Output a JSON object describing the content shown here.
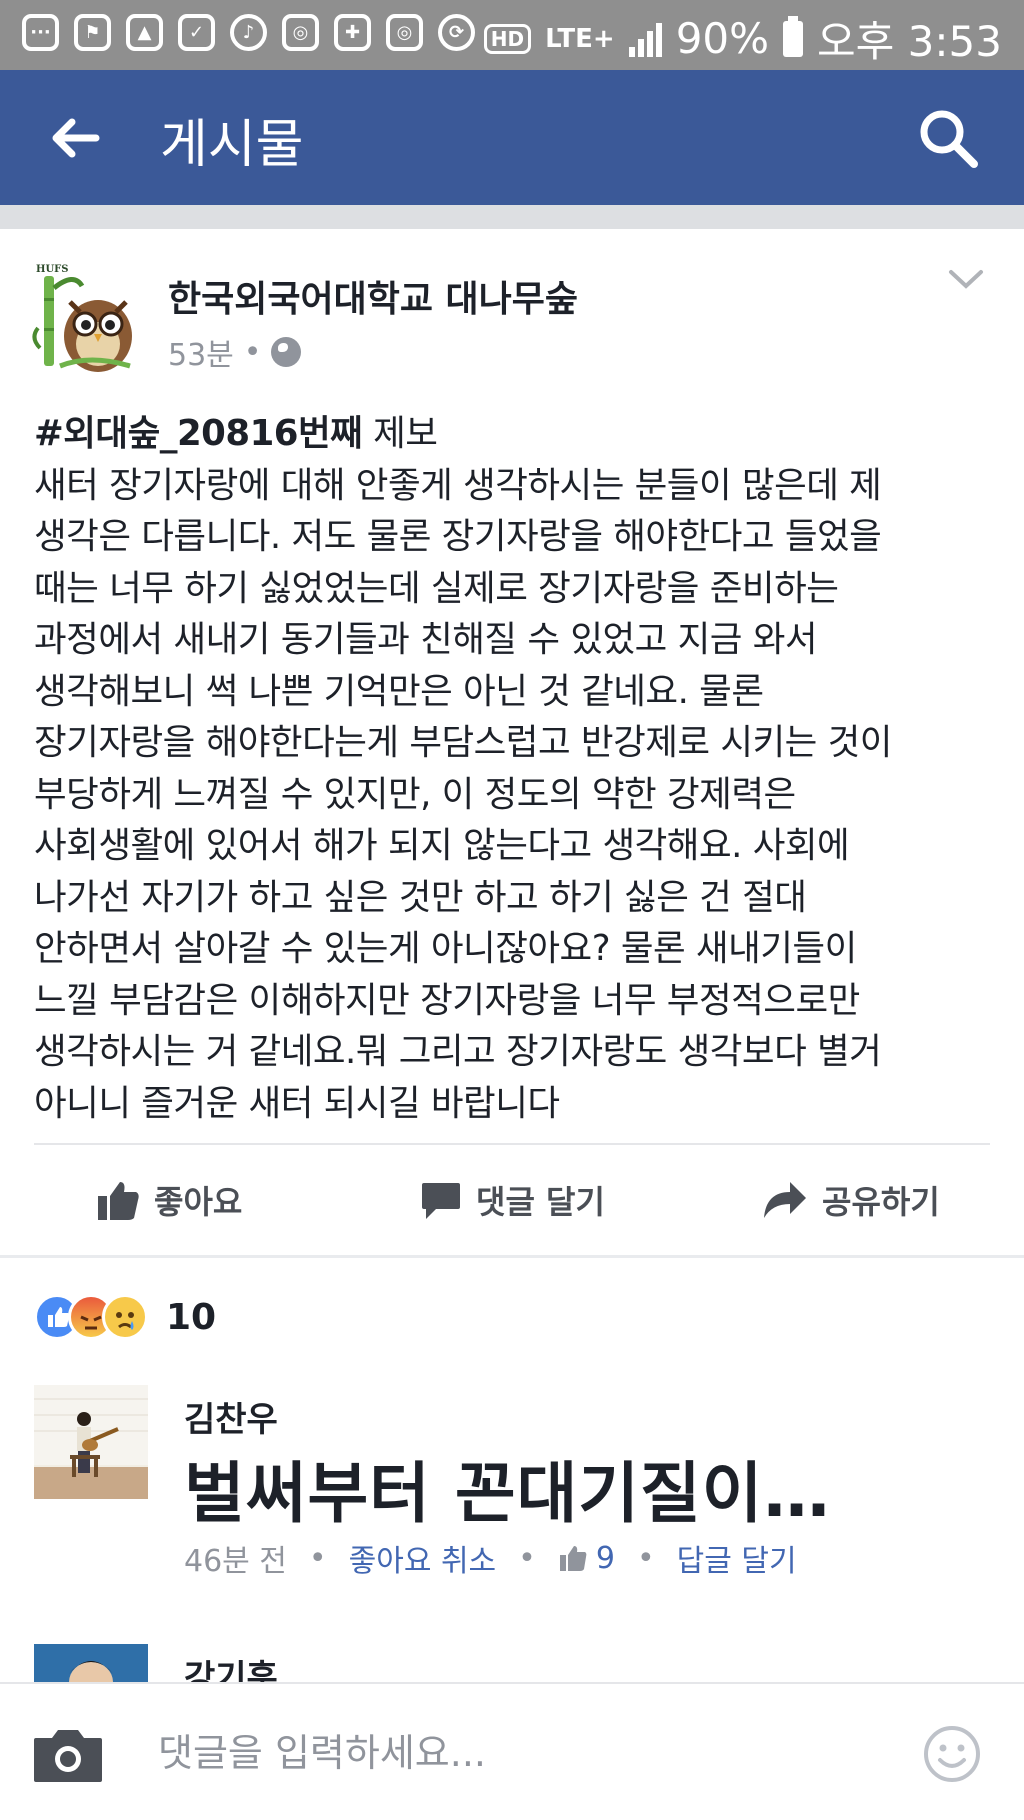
{
  "status_bar": {
    "battery": "90%",
    "time": "오후 3:53",
    "network": "LTE+",
    "hd": "HD"
  },
  "app_bar": {
    "title": "게시물"
  },
  "post": {
    "page_name": "한국외국어대학교 대나무숲",
    "avatar_text": "HUFS",
    "time": "53분",
    "hashtag": "#외대숲_20816번째",
    "hashtag_suffix": " 제보",
    "body": "새터 장기자랑에 대해 안좋게 생각하시는 분들이 많은데 제\n생각은 다릅니다. 저도 물론 장기자랑을 해야한다고 들었을\n때는 너무 하기 싫었었는데 실제로 장기자랑을 준비하는\n과정에서 새내기 동기들과 친해질 수 있었고 지금 와서\n생각해보니 썩 나쁜 기억만은 아닌 것 같네요. 물론\n장기자랑을 해야한다는게 부담스럽고 반강제로 시키는 것이\n부당하게 느껴질 수 있지만, 이 정도의 약한 강제력은\n사회생활에 있어서 해가 되지 않는다고 생각해요. 사회에\n나가선 자기가 하고 싶은 것만 하고 하기 싫은 건 절대\n안하면서 살아갈 수 있는게 아니잖아요? 물론 새내기들이\n느낄 부담감은 이해하지만 장기자랑을 너무 부정적으로만\n생각하시는 거 같네요.뭐 그리고 장기자랑도 생각보다 별거\n아니니 즐거운 새터 되시길 바랍니다"
  },
  "actions": {
    "like": "좋아요",
    "comment": "댓글 달기",
    "share": "공유하기"
  },
  "reactions": {
    "count": "10",
    "types": [
      "like",
      "angry",
      "sad"
    ]
  },
  "comments": [
    {
      "name": "김찬우",
      "text": "벌써부터 꼰대기질이…",
      "time": "46분 전",
      "like_action": "좋아요 취소",
      "likes": "9",
      "reply": "답글 달기"
    },
    {
      "name": "강기훈"
    }
  ],
  "composer": {
    "placeholder": "댓글을 입력하세요..."
  },
  "colors": {
    "brand_blue": "#3b5998",
    "link_blue": "#4267b2",
    "status_gray": "#8f8f8f"
  }
}
